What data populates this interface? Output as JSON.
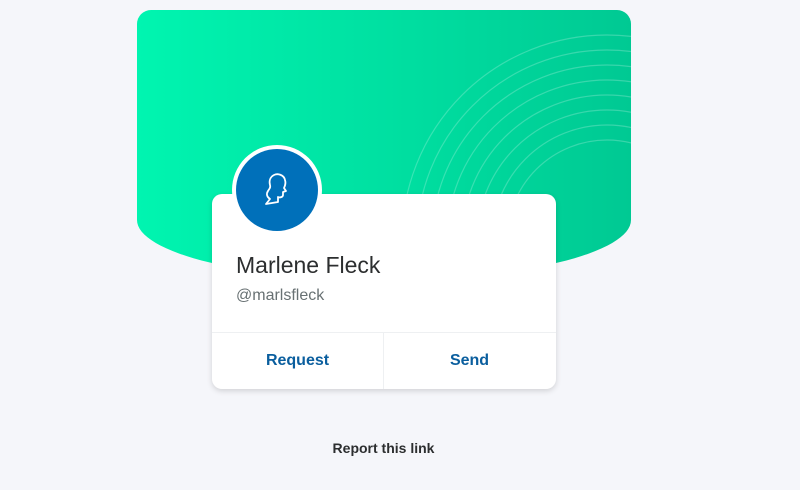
{
  "profile": {
    "name": "Marlene Fleck",
    "handle": "@marlsfleck",
    "avatar_icon": "profile-silhouette-icon"
  },
  "actions": {
    "request_label": "Request",
    "send_label": "Send"
  },
  "footer": {
    "report_label": "Report this link"
  },
  "colors": {
    "page_bg": "#f5f6fa",
    "banner_gradient_start": "#00f5b0",
    "banner_gradient_end": "#00c993",
    "avatar_bg": "#0070ba",
    "action_text": "#0a5e9e",
    "name_text": "#2c2e2f",
    "handle_text": "#687173"
  }
}
